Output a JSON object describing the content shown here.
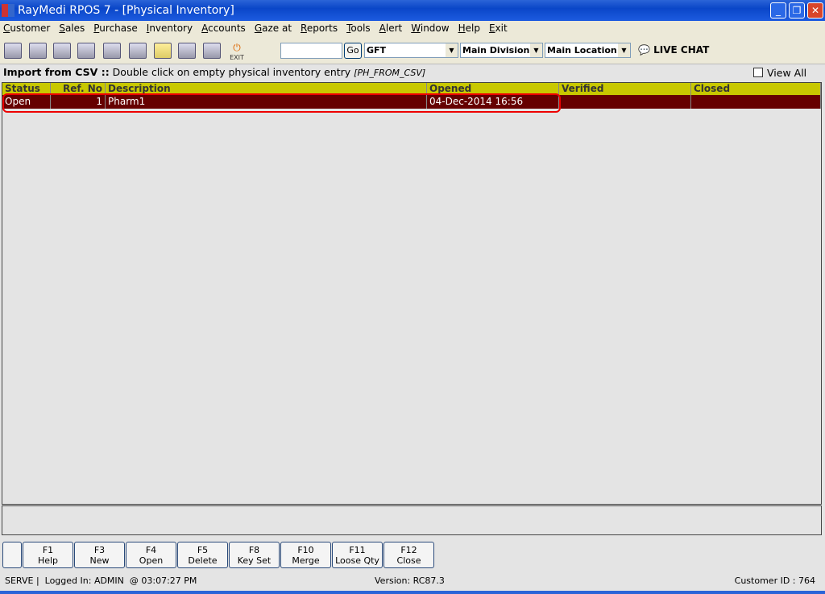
{
  "title": "RayMedi RPOS 7 - [Physical Inventory]",
  "menu": [
    "Customer",
    "Sales",
    "Purchase",
    "Inventory",
    "Accounts",
    "Gaze at",
    "Reports",
    "Tools",
    "Alert",
    "Window",
    "Help",
    "Exit"
  ],
  "toolbar": {
    "exit_label": "EXIT",
    "search_value": "",
    "go_label": "Go",
    "combo1": "GFT",
    "combo2": "Main Division",
    "combo3": "Main Location",
    "live_chat": "LIVE CHAT"
  },
  "info": {
    "bold": "Import from CSV ::",
    "text": " Double click on empty physical inventory entry ",
    "code": "[PH_FROM_CSV]"
  },
  "view_all": "View All",
  "grid": {
    "headers": [
      "Status",
      "Ref. No",
      "Description",
      "Opened",
      "Verified",
      "Closed"
    ],
    "rows": [
      [
        "Open",
        "1",
        "Pharm1",
        "04-Dec-2014 16:56",
        "",
        ""
      ]
    ]
  },
  "fkeys": [
    {
      "k": "F1",
      "l": "Help"
    },
    {
      "k": "F3",
      "l": "New"
    },
    {
      "k": "F4",
      "l": "Open"
    },
    {
      "k": "F5",
      "l": "Delete"
    },
    {
      "k": "F8",
      "l": "Key Set"
    },
    {
      "k": "F10",
      "l": "Merge"
    },
    {
      "k": "F11",
      "l": "Loose Qty"
    },
    {
      "k": "F12",
      "l": "Close"
    }
  ],
  "status": {
    "left": "SERVE |  Logged In: ADMIN  @ 03:07:27 PM",
    "version": "Version: RC87.3",
    "customer": "Customer ID : 764"
  }
}
